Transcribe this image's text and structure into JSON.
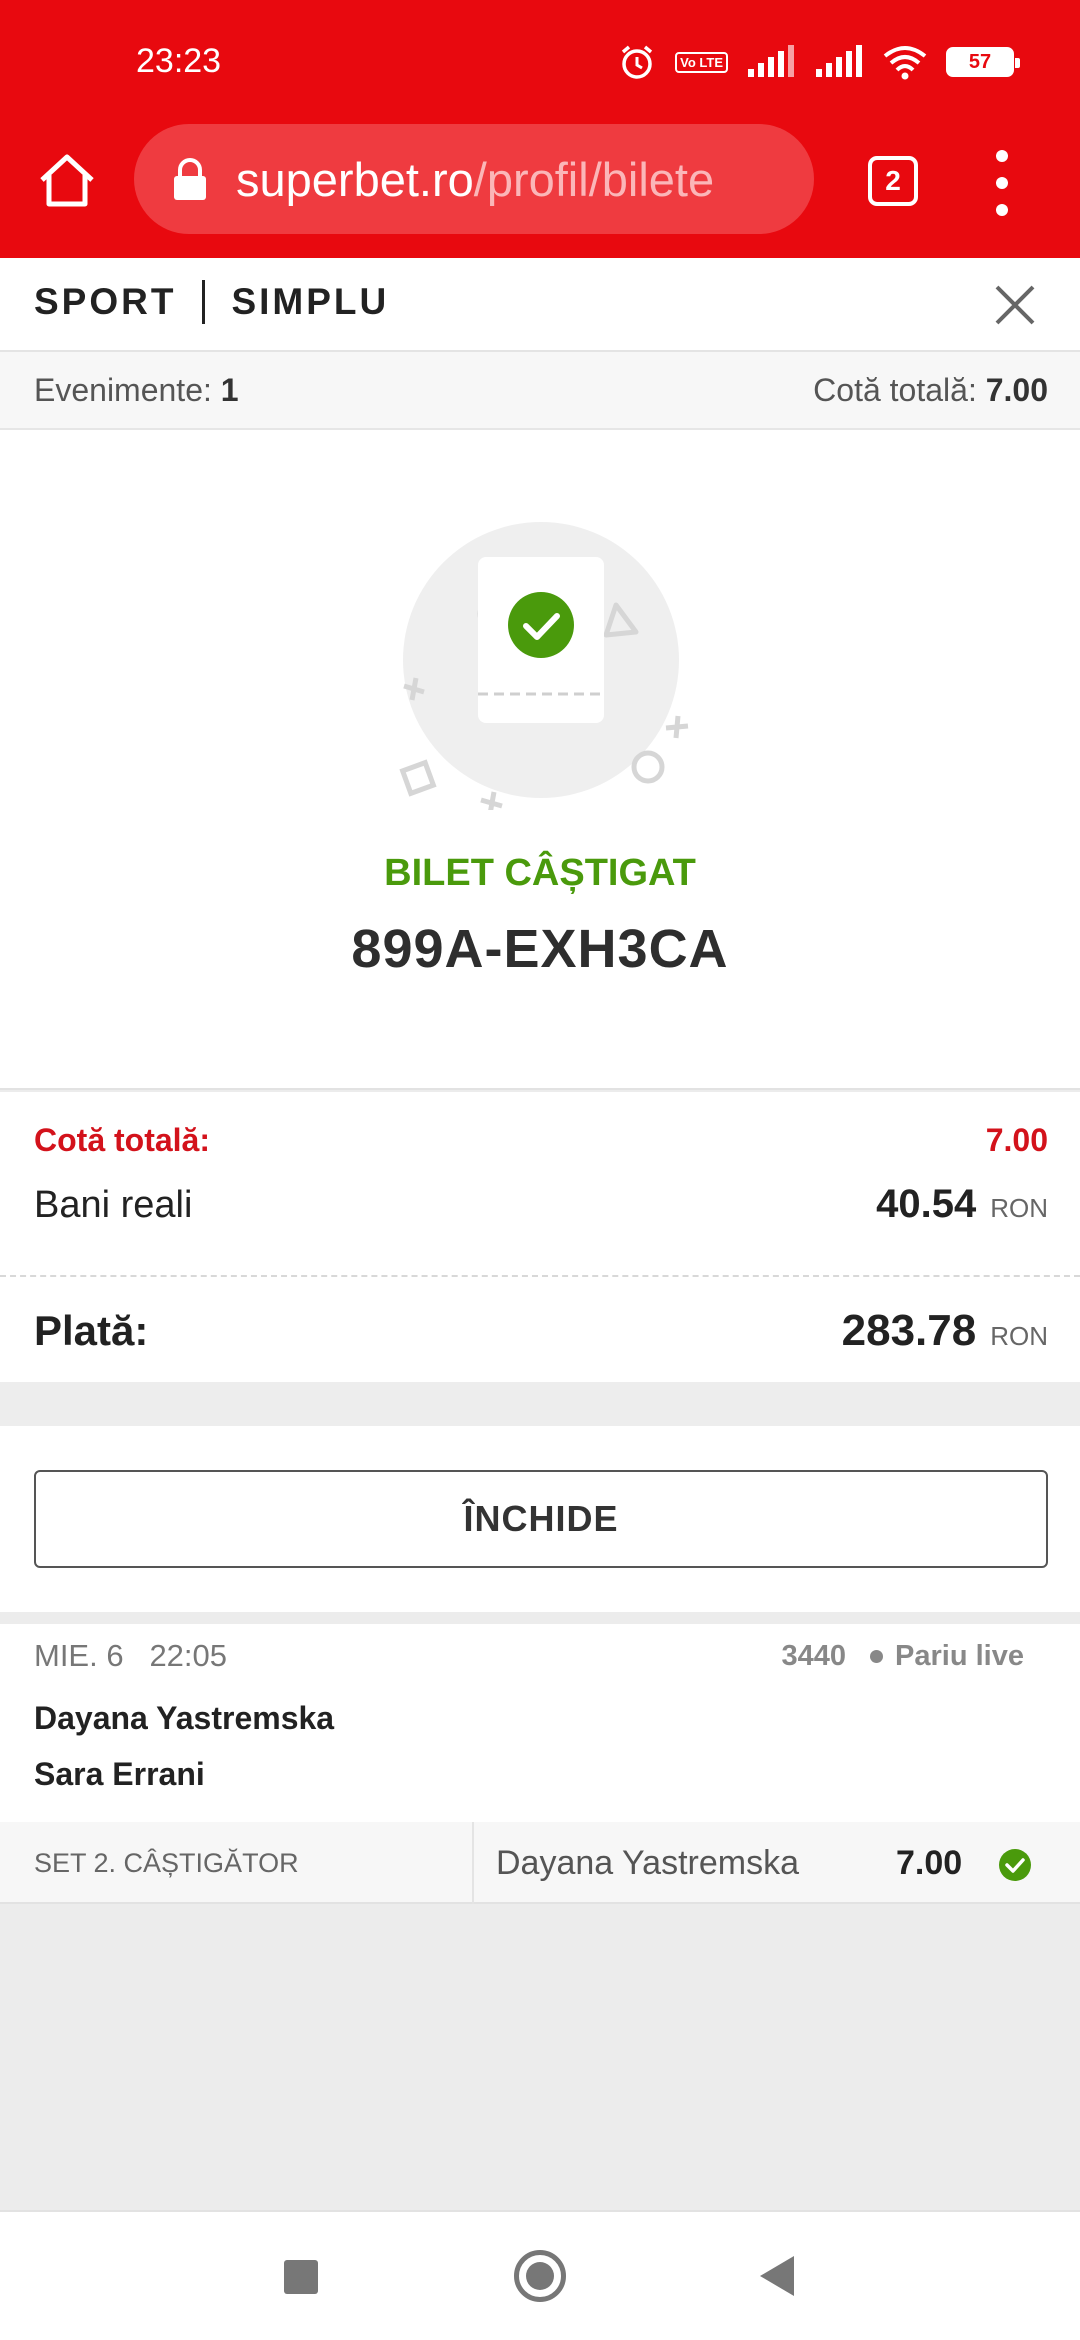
{
  "status_bar": {
    "time": "23:23",
    "volte": "Vo LTE",
    "battery": "57"
  },
  "browser": {
    "url_host": "superbet.ro",
    "url_path": "/profil/bilete",
    "tab_count": "2"
  },
  "ticket_header": {
    "type": "SPORT",
    "mode": "SIMPLU"
  },
  "summary": {
    "events_label": "Evenimente:",
    "events_count": "1",
    "total_odds_label": "Cotă totală:",
    "total_odds_value": "7.00"
  },
  "result": {
    "status": "BILET CÂȘTIGAT",
    "code": "899A-EXH3CA",
    "status_color": "#4a9a0c"
  },
  "totals": {
    "odds_label": "Cotă totală:",
    "odds_value": "7.00",
    "stake_label": "Bani reali",
    "stake_value": "40.54",
    "stake_unit": "RON",
    "payout_label": "Plată:",
    "payout_value": "283.78",
    "payout_unit": "RON"
  },
  "close_button": "ÎNCHIDE",
  "event": {
    "date": "MIE. 6",
    "time": "22:05",
    "event_id": "3440",
    "badge": "Pariu live",
    "player1": "Dayana Yastremska",
    "player2": "Sara Errani",
    "market": "SET 2. CÂȘTIGĂTOR",
    "pick": "Dayana Yastremska",
    "odds": "7.00"
  },
  "colors": {
    "brand_red": "#e8090f",
    "win_green": "#4a9a0c",
    "accent_red": "#d3121b"
  }
}
